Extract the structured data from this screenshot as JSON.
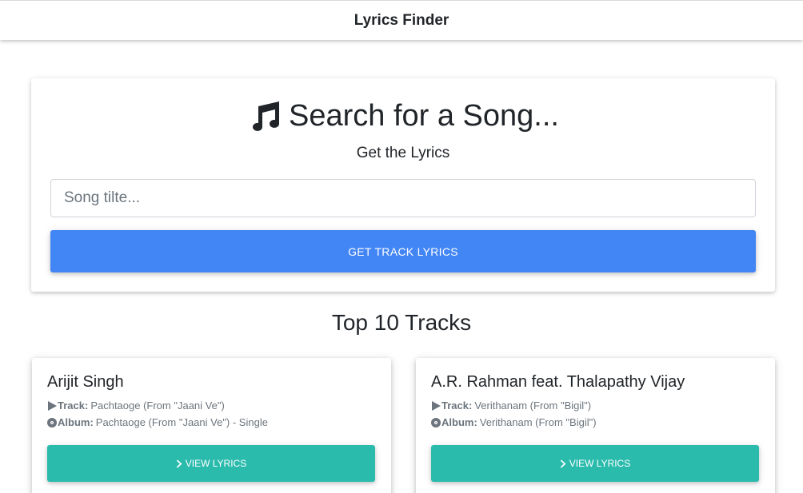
{
  "navbar": {
    "brand": "Lyrics Finder"
  },
  "search": {
    "title": "Search for a Song...",
    "title_icon": "music-note-icon",
    "subtitle": "Get the Lyrics",
    "input_placeholder": "Song tilte...",
    "input_value": "",
    "button_label": "GET TRACK LYRICS",
    "button_color": "#4285f4"
  },
  "tracks_section": {
    "title": "Top 10 Tracks",
    "tracks": [
      {
        "artist": "Arijit Singh",
        "track_label": "Track:",
        "track_name": "Pachtaoge (From \"Jaani Ve\")",
        "album_label": "Album:",
        "album_name": "Pachtaoge (From \"Jaani Ve\") - Single",
        "button_label": "VIEW LYRICS"
      },
      {
        "artist": "A.R. Rahman feat. Thalapathy Vijay",
        "track_label": "Track:",
        "track_name": "Verithanam (From \"Bigil\")",
        "album_label": "Album:",
        "album_name": "Verithanam (From \"Bigil\")",
        "button_label": "VIEW LYRICS"
      }
    ],
    "button_color": "#2bbbad"
  }
}
